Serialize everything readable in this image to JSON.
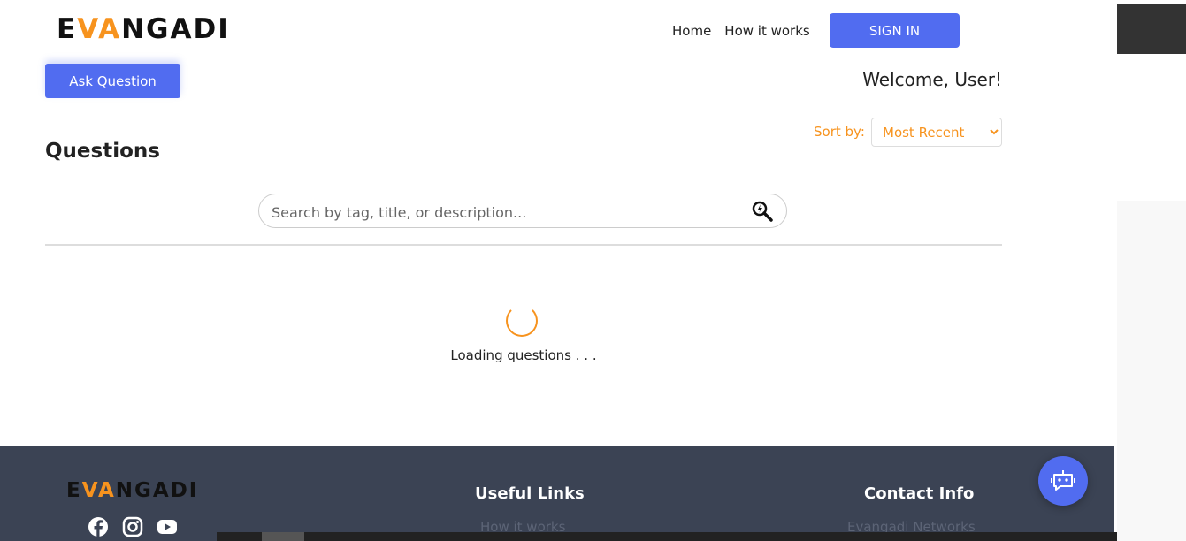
{
  "brand": {
    "logo_left": "E",
    "logo_accent": "VA",
    "logo_right": "NGADI",
    "accent_color": "#f7931e",
    "primary_color": "#516cf0"
  },
  "header": {
    "nav": [
      "Home",
      "How it works"
    ],
    "sign_in_label": "SIGN IN"
  },
  "main": {
    "ask_button_label": "Ask Question",
    "welcome_text": "Welcome, User!",
    "sort_label": "Sort by:",
    "sort_selected": "Most Recent",
    "title": "Questions",
    "search_placeholder": "Search by tag, title, or description...",
    "loading_text": "Loading questions . . ."
  },
  "footer": {
    "useful_links_heading": "Useful Links",
    "useful_links": [
      "How it works"
    ],
    "contact_heading": "Contact Info",
    "contact_items": [
      "Evangadi Networks"
    ],
    "social_icons": [
      "facebook-icon",
      "instagram-icon",
      "youtube-icon"
    ]
  },
  "chat": {
    "icon": "chatbot-icon"
  }
}
